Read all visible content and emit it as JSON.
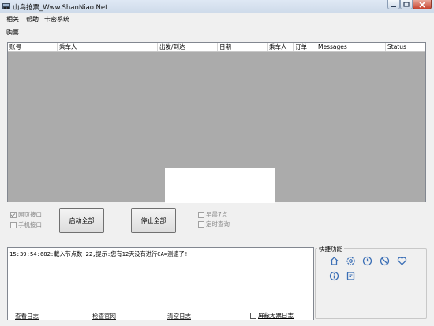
{
  "window": {
    "title": "山鸟抢票_Www.ShanNiao.Net"
  },
  "menu": [
    {
      "label": "相关"
    },
    {
      "label": "帮助"
    },
    {
      "label": "卡密系统"
    }
  ],
  "tabs": [
    {
      "label": "购票"
    }
  ],
  "table": {
    "columns": [
      "账号",
      "乘车人",
      "出发/到达",
      "日期",
      "乘车人",
      "订单",
      "Messages",
      "Status"
    ],
    "rows": []
  },
  "options": {
    "web_api": {
      "label": "网页接口",
      "checked": true
    },
    "mobile_api": {
      "label": "手机接口",
      "checked": false
    },
    "early7": {
      "label": "早晨7点",
      "checked": false
    },
    "timed_query": {
      "label": "定时查询",
      "checked": false
    }
  },
  "buttons": {
    "start_all": "启动全部",
    "stop_all": "停止全部"
  },
  "log": {
    "line1": "15:39:54:682:载入节点数:22,提示:您有12天没有进行CA=测速了!"
  },
  "quick": {
    "title": "快捷功能",
    "icons": [
      "home-icon",
      "gear-icon",
      "clock-icon",
      "forbid-icon",
      "heart-icon",
      "info-icon",
      "notebook-icon"
    ],
    "color": "#3b6fb6"
  },
  "footer": {
    "view_log": "查看日志",
    "check_official": "检查官网",
    "clear_log": "清空日志",
    "hide_no_ticket": "屏蔽无票日志"
  }
}
